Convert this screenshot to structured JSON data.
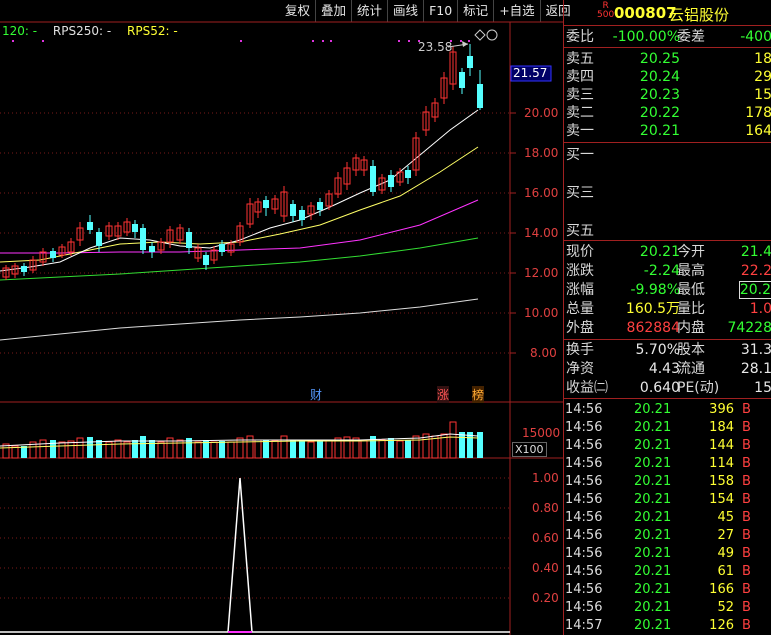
{
  "toolbar": {
    "buttons": [
      "复权",
      "叠加",
      "统计",
      "画线",
      "F10",
      "标记",
      "+自选",
      "返回"
    ]
  },
  "indicators": {
    "ma_label": "120: -",
    "rps250": "RPS250: -",
    "rps52": "RPS52: -"
  },
  "price_axis": {
    "ticks": [
      "20.00",
      "18.00",
      "16.00",
      "14.00",
      "12.00",
      "10.00",
      "8.00"
    ],
    "current_price_tag": "21.57",
    "high_label": "23.58"
  },
  "markers": {
    "finance": "财",
    "limit_up": "涨",
    "ranking": "榜"
  },
  "volume_axis": {
    "tick": "15000",
    "unit": "X100"
  },
  "indicator_axis": {
    "ticks": [
      "1.00",
      "0.80",
      "0.60",
      "0.40",
      "0.20"
    ]
  },
  "stock": {
    "badge_top": "R",
    "badge_bottom": "500",
    "code": "000807",
    "name": "云铝股份"
  },
  "order_book": {
    "weibi_label": "委比",
    "weibi_value": "-100.00%",
    "weicha_label": "委差",
    "weicha_value": "-400",
    "asks": [
      {
        "label": "卖五",
        "price": "20.25",
        "vol": "18"
      },
      {
        "label": "卖四",
        "price": "20.24",
        "vol": "29"
      },
      {
        "label": "卖三",
        "price": "20.23",
        "vol": "15"
      },
      {
        "label": "卖二",
        "price": "20.22",
        "vol": "178"
      },
      {
        "label": "卖一",
        "price": "20.21",
        "vol": "164"
      }
    ],
    "bids": [
      {
        "label": "买一"
      },
      {
        "label": "买三"
      },
      {
        "label": "买五"
      }
    ]
  },
  "quote": {
    "rows": [
      {
        "k1": "现价",
        "v1": "20.21",
        "k2": "今开",
        "v2": "21.4"
      },
      {
        "k1": "涨跌",
        "v1": "-2.24",
        "k2": "最高",
        "v2": "22.2"
      },
      {
        "k1": "涨幅",
        "v1": "-9.98%",
        "k2": "最低",
        "v2": "20.2"
      },
      {
        "k1": "总量",
        "v1": "160.5万",
        "k2": "量比",
        "v2": "1.0"
      },
      {
        "k1": "外盘",
        "v1": "862884",
        "k2": "内盘",
        "v2": "74228"
      }
    ],
    "fund_rows": [
      {
        "k1": "换手",
        "v1": "5.70%",
        "k2": "股本",
        "v2": "31.3"
      },
      {
        "k1": "净资",
        "v1": "4.43",
        "k2": "流通",
        "v2": "28.1"
      },
      {
        "k1": "收益㈡",
        "v1": "0.640",
        "k2": "PE(动)",
        "v2": "15"
      }
    ]
  },
  "ticks": [
    {
      "time": "14:56",
      "price": "20.21",
      "qty": "396",
      "flag": "B"
    },
    {
      "time": "14:56",
      "price": "20.21",
      "qty": "184",
      "flag": "B"
    },
    {
      "time": "14:56",
      "price": "20.21",
      "qty": "144",
      "flag": "B"
    },
    {
      "time": "14:56",
      "price": "20.21",
      "qty": "114",
      "flag": "B"
    },
    {
      "time": "14:56",
      "price": "20.21",
      "qty": "158",
      "flag": "B"
    },
    {
      "time": "14:56",
      "price": "20.21",
      "qty": "154",
      "flag": "B"
    },
    {
      "time": "14:56",
      "price": "20.21",
      "qty": "45",
      "flag": "B"
    },
    {
      "time": "14:56",
      "price": "20.21",
      "qty": "27",
      "flag": "B"
    },
    {
      "time": "14:56",
      "price": "20.21",
      "qty": "49",
      "flag": "B"
    },
    {
      "time": "14:56",
      "price": "20.21",
      "qty": "61",
      "flag": "B"
    },
    {
      "time": "14:56",
      "price": "20.21",
      "qty": "166",
      "flag": "B"
    },
    {
      "time": "14:56",
      "price": "20.21",
      "qty": "52",
      "flag": "B"
    },
    {
      "time": "14:57",
      "price": "20.21",
      "qty": "126",
      "flag": "B"
    }
  ],
  "colors": {
    "up": "#ff3333",
    "down": "#55ffff",
    "grid": "#a02020",
    "ma_white": "#ffffff",
    "ma_yellow": "#ffff66",
    "ma_magenta": "#ff33ff",
    "ma_green": "#33dd33",
    "ma_long": "#dddddd"
  }
}
